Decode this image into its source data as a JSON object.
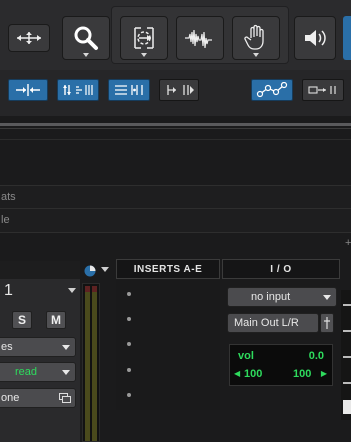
{
  "colors": {
    "accent_blue": "#2a6fa8",
    "panel_dark": "#1b1b1c",
    "green_text": "#2edb5d",
    "meter_olive": "#5a5a20"
  },
  "toolbar_top": {
    "tools": [
      {
        "name": "zoom-to-fit",
        "icon": "four-arrows-icon"
      },
      {
        "name": "zoomer",
        "icon": "magnifier-icon"
      },
      {
        "name": "trim",
        "icon": "trim-tool-icon"
      },
      {
        "name": "selector",
        "icon": "waveform-selector-icon"
      },
      {
        "name": "grabber",
        "icon": "hand-icon"
      },
      {
        "name": "scrubber",
        "icon": "speaker-icon"
      }
    ]
  },
  "toolbar_edit": {
    "buttons": [
      {
        "icon": "shuffle-mode-icon",
        "active": true
      },
      {
        "icon": "spot-mode-icon",
        "active": true
      },
      {
        "icon": "slip-mode-icon",
        "active": true
      },
      {
        "icon": "grid-mode-icon",
        "active": false
      },
      {
        "icon": "link-icon",
        "active": true
      },
      {
        "icon": "tab-to-transient-icon",
        "active": false
      }
    ]
  },
  "rows": {
    "row1": "ats",
    "row2": "le"
  },
  "mixer": {
    "inserts_header": "INSERTS A-E",
    "io_header": "I / O",
    "track_number": "1",
    "solo_label": "S",
    "mute_label": "M",
    "row_es": "es",
    "automation_mode": "read",
    "group_label": "one",
    "input_value": "no input",
    "output_value": "Main Out L/R",
    "vol_label": "vol",
    "vol_value": "0.0",
    "pan_left": "100",
    "pan_right": "100"
  }
}
